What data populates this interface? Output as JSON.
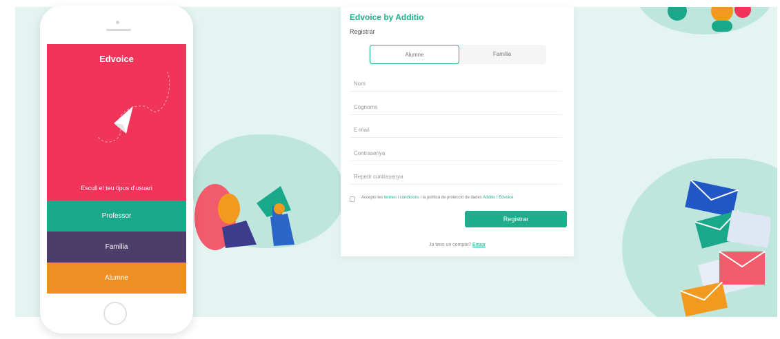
{
  "phone": {
    "brand": "Edvoice",
    "tagline": "Escull el teu tipus d'usuari",
    "bands": [
      {
        "label": "Professor",
        "color": "#1aa88a"
      },
      {
        "label": "Família",
        "color": "#4c3e69"
      },
      {
        "label": "Alumne",
        "color": "#ef8f23"
      }
    ],
    "screen_color": "#f0345a"
  },
  "form": {
    "title": "Edvoice by Additio",
    "subtitle": "Registrar",
    "toggle": {
      "active": "Alumne",
      "other": "Família"
    },
    "fields": [
      {
        "name": "nom-field",
        "placeholder": "Nom"
      },
      {
        "name": "cognoms-field",
        "placeholder": "Cognoms"
      },
      {
        "name": "email-field",
        "placeholder": "E-mail"
      },
      {
        "name": "password-field",
        "placeholder": "Contrasenya"
      },
      {
        "name": "repeat-password-field",
        "placeholder": "Repetir contrasenya"
      }
    ],
    "terms": {
      "prefix": "Accepto les",
      "link1": "termes i condicions",
      "middle": "i la política de protecció de dades",
      "link2": "Additio i Edvoice"
    },
    "submit_label": "Registrar",
    "login_prompt": "Ja tens un compte?",
    "login_link": "Entrar"
  },
  "colors": {
    "accent": "#1fae8b",
    "background": "#e4f4f1",
    "pink": "#f0345a",
    "purple": "#4c3e69",
    "orange": "#ef8f23"
  }
}
